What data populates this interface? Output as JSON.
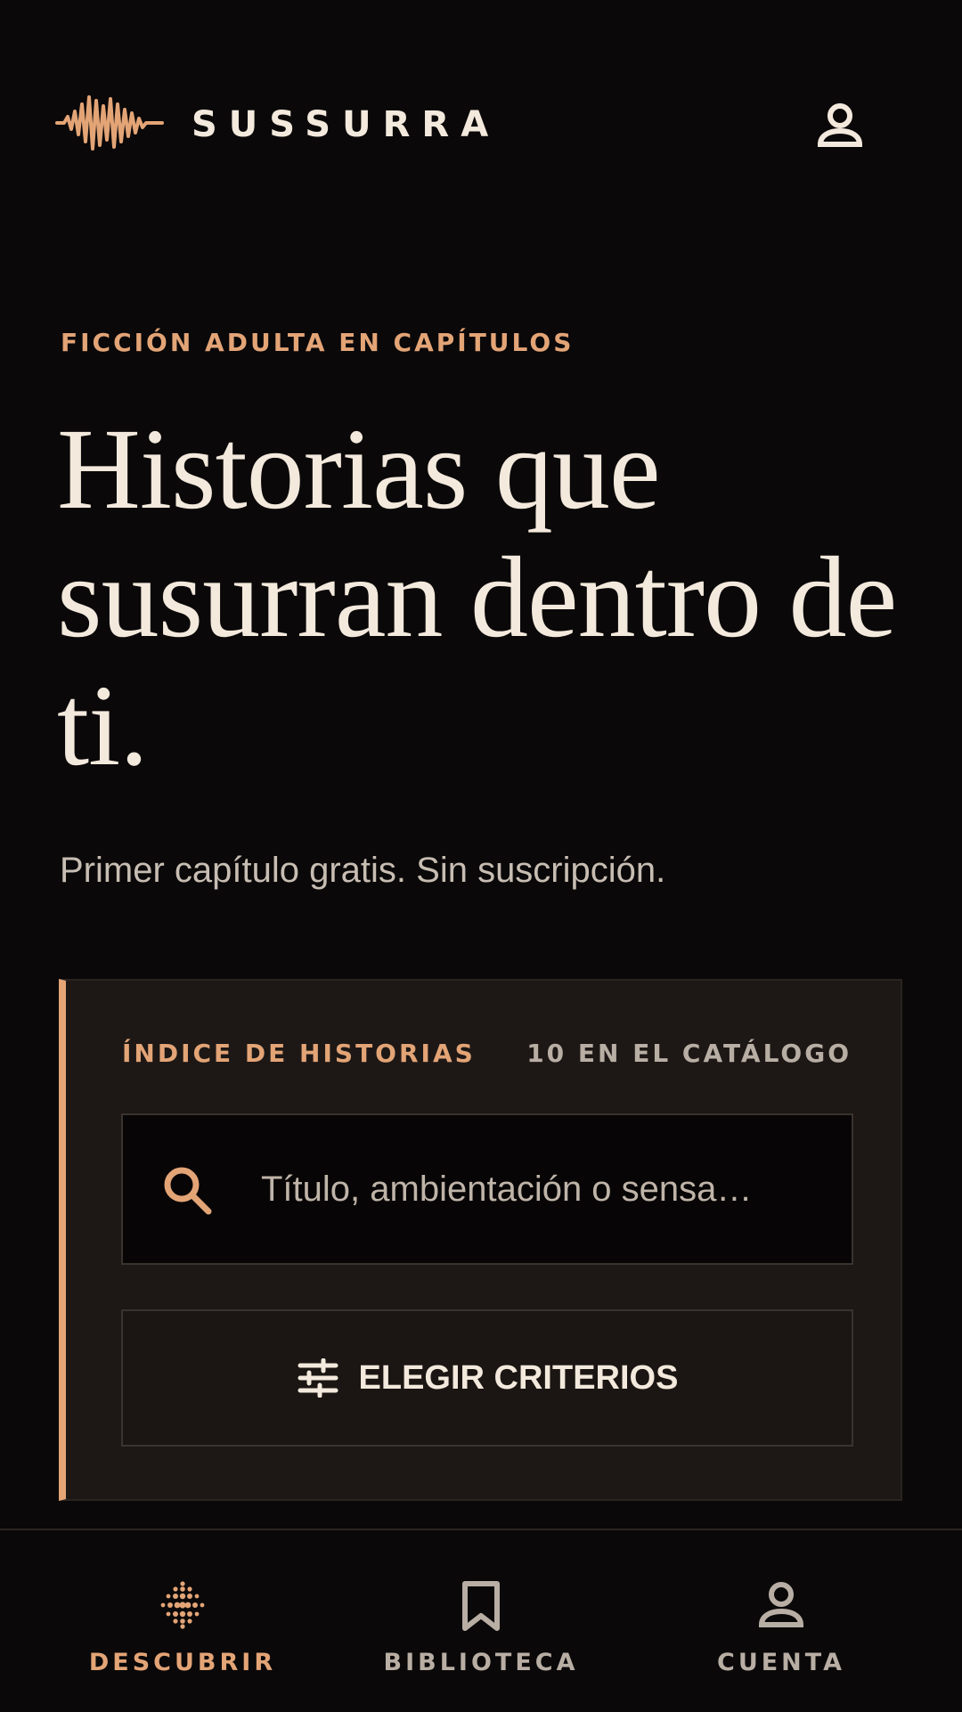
{
  "colors": {
    "background": "#0a0809",
    "accent": "#e3a476",
    "text": "#f3e9dc",
    "muted": "#b8aea4",
    "card": "#1d1816"
  },
  "header": {
    "brand": "SUSSURRA",
    "logo_icon": "waveform-icon",
    "account_icon": "user-icon"
  },
  "hero": {
    "eyebrow": "FICCIÓN ADULTA EN CAPÍTULOS",
    "title": "Historias que susurran dentro de ti.",
    "subtitle": "Primer capítulo gratis. Sin suscripción."
  },
  "index_card": {
    "label": "ÍNDICE DE HISTORIAS",
    "count": "10 EN EL CATÁLOGO",
    "search": {
      "placeholder": "Título, ambientación o sensa…",
      "value": "",
      "icon": "search-icon"
    },
    "criteria_button": {
      "label": "ELEGIR CRITERIOS",
      "icon": "sliders-icon"
    }
  },
  "bottom_nav": {
    "items": [
      {
        "label": "DESCUBRIR",
        "icon": "dot-grid-icon",
        "active": true
      },
      {
        "label": "BIBLIOTECA",
        "icon": "bookmark-icon",
        "active": false
      },
      {
        "label": "CUENTA",
        "icon": "user-icon",
        "active": false
      }
    ]
  }
}
